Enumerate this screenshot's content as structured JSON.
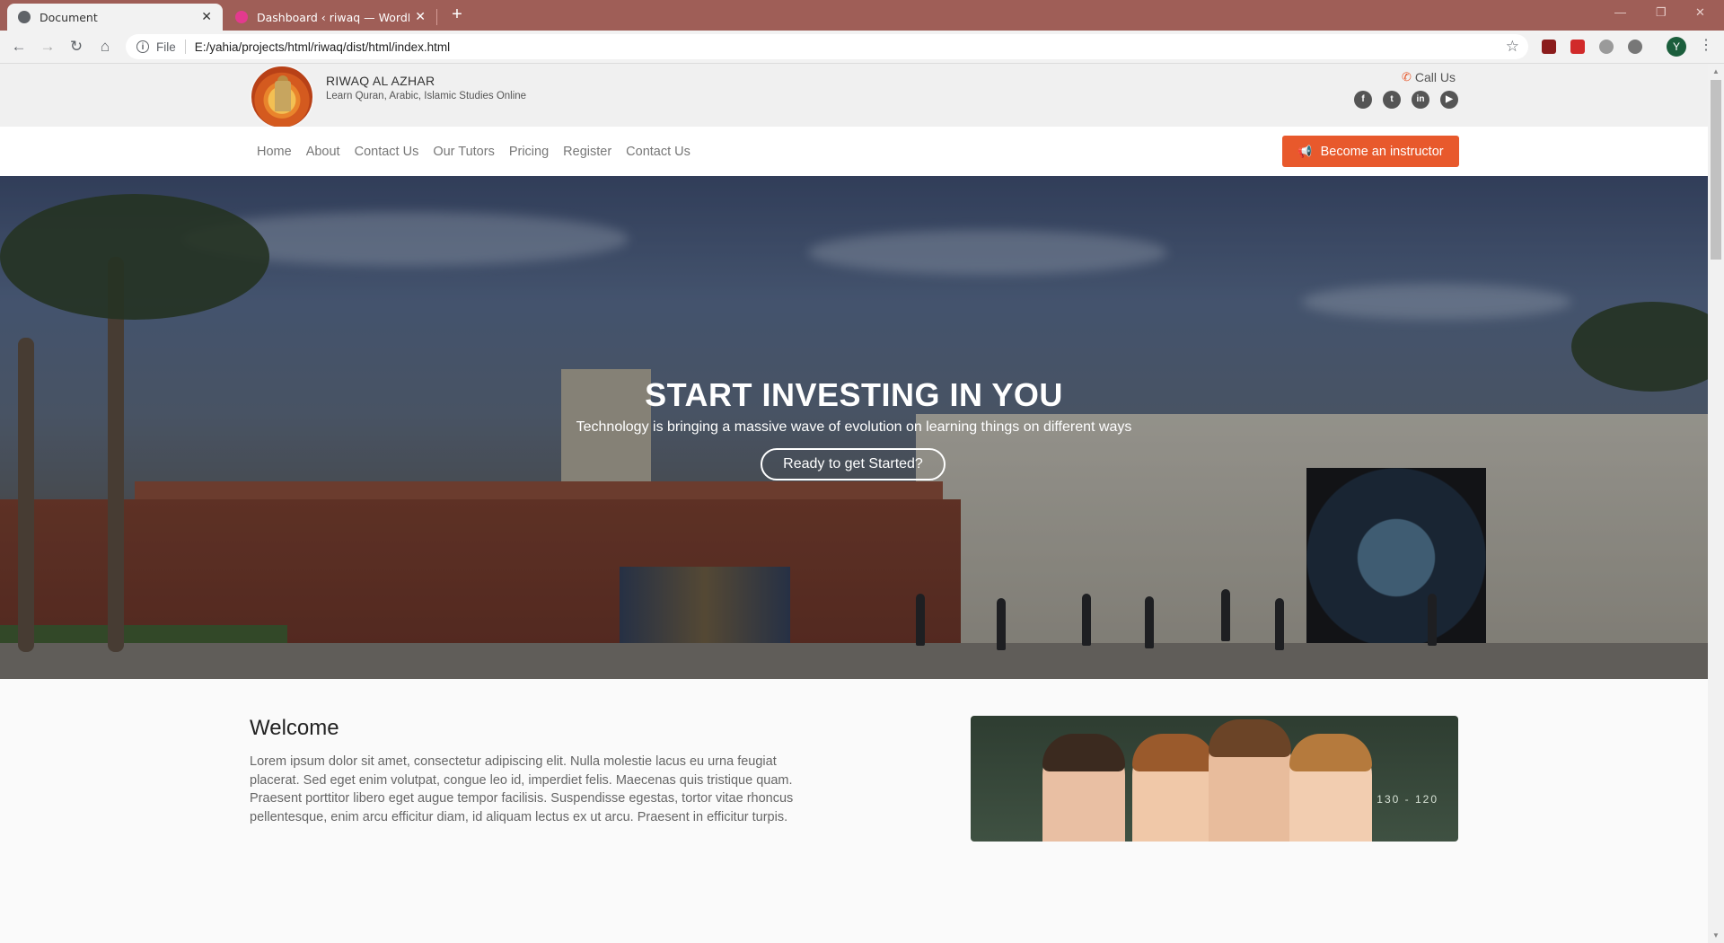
{
  "browser": {
    "tabs": [
      {
        "title": "Document",
        "active": true
      },
      {
        "title": "Dashboard ‹ riwaq — WordPress",
        "active": false
      }
    ],
    "address_scheme": "File",
    "address_url": "E:/yahia/projects/html/riwaq/dist/html/index.html",
    "profile_initial": "Y",
    "frame_color": "#9f5e57"
  },
  "site": {
    "brand_name": "RIWAQ AL AZHAR",
    "brand_tagline": "Learn Quran, Arabic, Islamic Studies Online",
    "call_us": "Call Us",
    "social_icons": [
      "facebook-icon",
      "twitter-icon",
      "linkedin-icon",
      "youtube-icon"
    ],
    "nav": [
      "Home",
      "About",
      "Contact Us",
      "Our Tutors",
      "Pricing",
      "Register",
      "Contact Us"
    ],
    "cta_label": "Become an instructor",
    "accent_color": "#e8592c"
  },
  "hero": {
    "title": "START INVESTING IN YOU",
    "subtitle": "Technology is bringing a massive wave of evolution on learning things on different ways",
    "button_label": "Ready to get Started?"
  },
  "welcome": {
    "title": "Welcome",
    "body": "Lorem ipsum dolor sit amet, consectetur adipiscing elit. Nulla molestie lacus eu urna feugiat placerat. Sed eget enim volutpat, congue leo id, imperdiet felis. Maecenas quis tristique quam. Praesent porttitor libero eget augue tempor facilisis. Suspendisse egestas, tortor vitae rhoncus pellentesque, enim arcu efficitur diam, id aliquam lectus ex ut arcu. Praesent in efficitur turpis."
  }
}
